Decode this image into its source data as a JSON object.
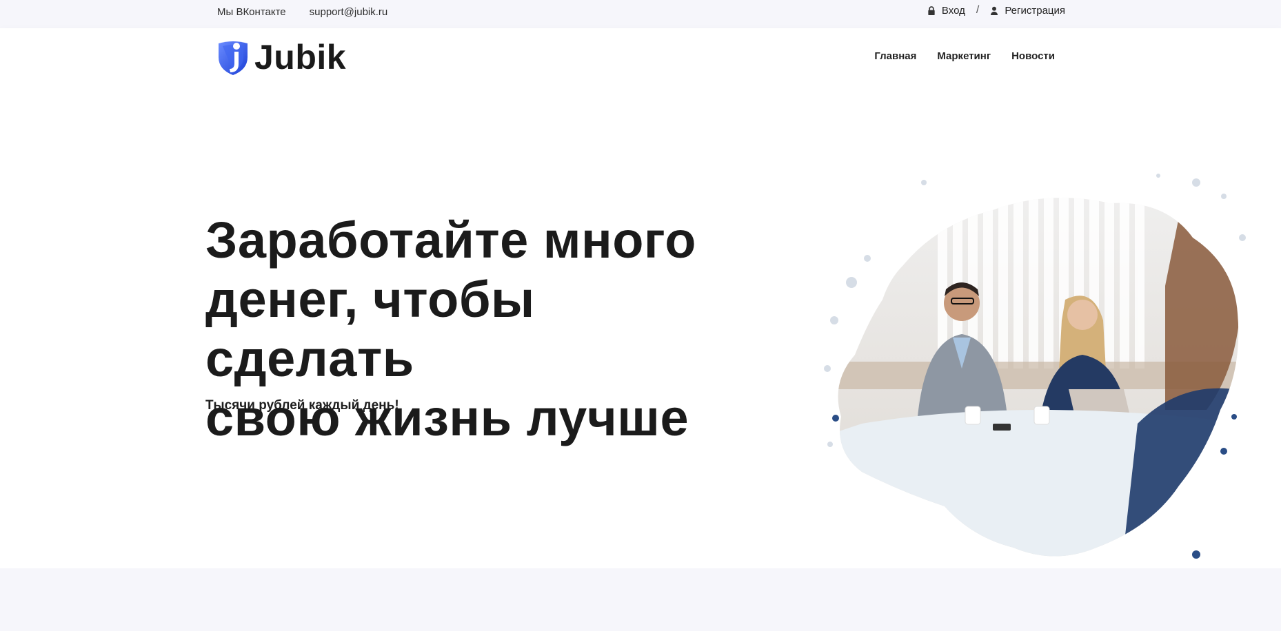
{
  "topbar": {
    "vk_label": "Мы ВКонтакте",
    "email": "support@jubik.ru",
    "login_label": "Вход",
    "login_icon": "lock-icon",
    "separator": "/",
    "register_label": "Регистрация",
    "register_icon": "user-icon"
  },
  "navbar": {
    "logo_text": "Jubik",
    "logo_icon": "shield-logo-icon",
    "menu": [
      {
        "label": "Главная"
      },
      {
        "label": "Маркетинг"
      },
      {
        "label": "Новости"
      }
    ]
  },
  "hero": {
    "title_line1": "Заработайте много",
    "title_line2": "денег, чтобы сделать",
    "title_line3": "свою жизнь лучше",
    "subtitle": "Тысячи рублей каждый день!"
  },
  "colors": {
    "topbar_bg": "#f6f6fb",
    "logo_blue": "#2f5bea",
    "text_dark": "#1b1b1b",
    "band_bg": "#f6f6fb"
  }
}
